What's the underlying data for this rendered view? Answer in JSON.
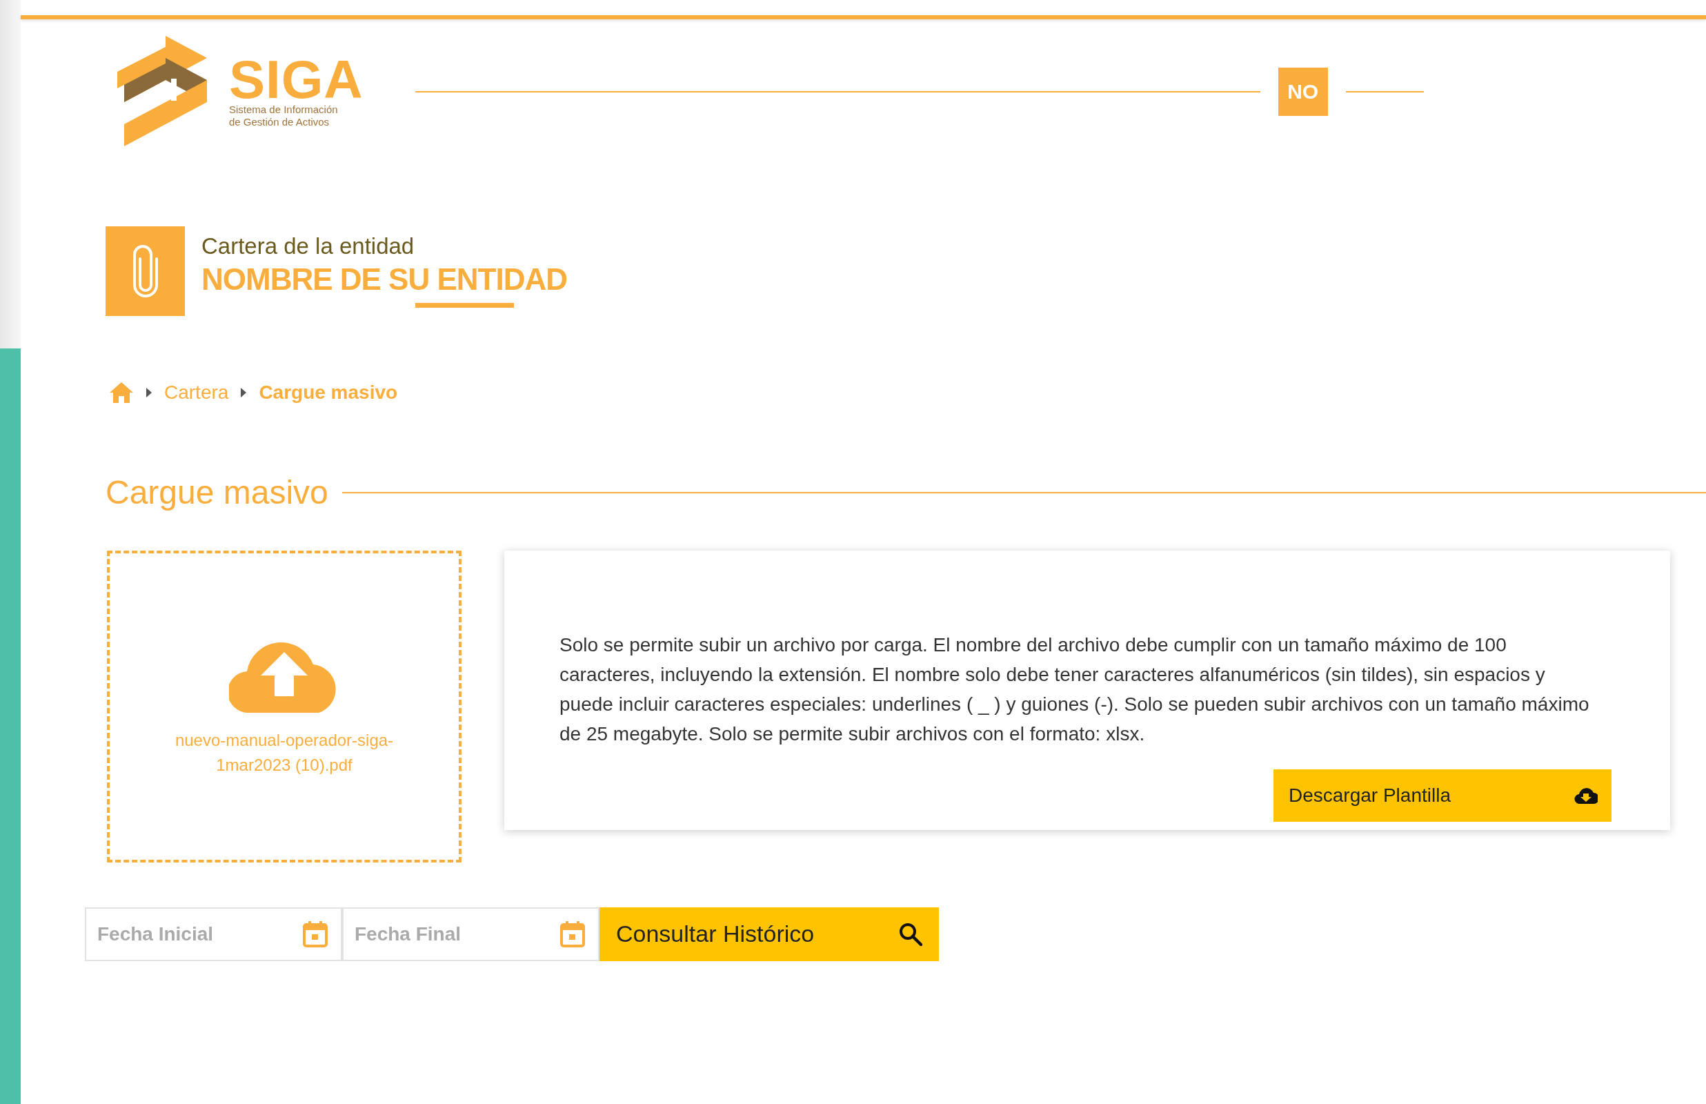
{
  "header": {
    "logo": {
      "name": "SIGA",
      "subtitle_line_1": "Sistema de Información",
      "subtitle_line_2": "de Gestión de Activos"
    },
    "badge": "NO"
  },
  "title": {
    "subtitle": "Cartera de la entidad",
    "entity": "NOMBRE DE SU ENTIDAD"
  },
  "breadcrumb": [
    {
      "label": "Cartera",
      "current": false
    },
    {
      "label": "Cargue masivo",
      "current": true
    }
  ],
  "section_title": "Cargue masivo",
  "upload": {
    "file_name": "nuevo-manual-operador-siga-1mar2023 (10).pdf"
  },
  "info": {
    "text": "Solo se permite subir un archivo por carga. El nombre del archivo debe cumplir con un tamaño máximo de 100 caracteres, incluyendo la extensión. El nombre solo debe tener caracteres alfanuméricos (sin tildes), sin espacios y puede incluir caracteres especiales: underlines ( _ ) y guiones (-). Solo se pueden subir archivos con un tamaño máximo de 25 megabyte. Solo se permite subir archivos con el formato: xlsx.",
    "button": "Descargar Plantilla"
  },
  "filters": {
    "start_date": {
      "placeholder": "Fecha Inicial"
    },
    "end_date": {
      "placeholder": "Fecha Final"
    },
    "button": "Consultar Histórico"
  }
}
